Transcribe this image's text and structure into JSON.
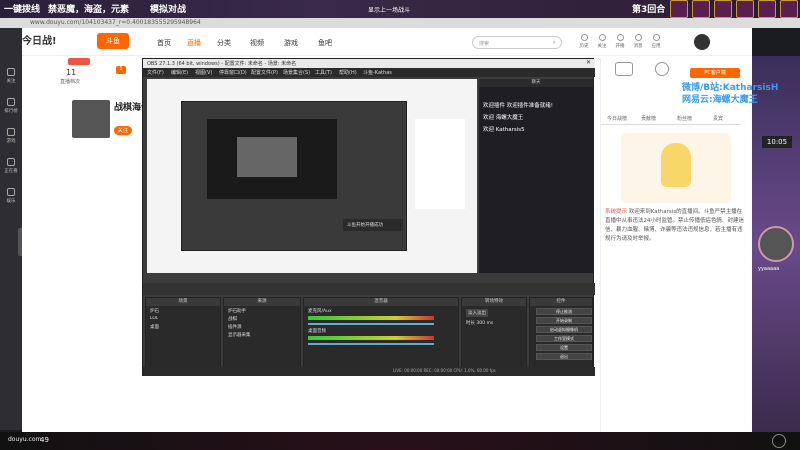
{
  "banner": {
    "promo": "一键拨线",
    "slogan": "禁恶魔，海盗，元素",
    "mode": "模拟对战",
    "center": "显示上一场战斗",
    "round": "第3回合"
  },
  "browser": {
    "url": "www.douyu.com/104103437_r=0.400183555295948964"
  },
  "nav": {
    "logo": "今日战!",
    "douyu": "斗鱼",
    "home": "首页",
    "live": "直播",
    "category": "分类",
    "video": "视频",
    "game": "游戏",
    "fishbar": "鱼吧",
    "search_placeholder": "搜索"
  },
  "top_icons": [
    {
      "label": "历史",
      "icon": "history-icon"
    },
    {
      "label": "关注",
      "icon": "follow-icon"
    },
    {
      "label": "开播",
      "icon": "broadcast-icon"
    },
    {
      "label": "消息",
      "icon": "message-icon"
    },
    {
      "label": "应用",
      "icon": "app-icon"
    }
  ],
  "left_sidebar": [
    {
      "label": "关注",
      "icon": "heart-icon"
    },
    {
      "label": "排行榜",
      "icon": "rank-icon"
    },
    {
      "label": "游戏",
      "icon": "game-icon"
    },
    {
      "label": "正在看",
      "icon": "watch-icon"
    },
    {
      "label": "娱乐",
      "icon": "fun-icon"
    }
  ],
  "meta": {
    "level": "11",
    "rank": "直播档次",
    "badge": "1"
  },
  "streamer": {
    "name": "战棋海士",
    "fans": "关注"
  },
  "obs": {
    "title": "OBS 27.1.3 (64 bit, windows) - 配置文件: 未命名 - 场景: 未命名",
    "menu": [
      "文件(F)",
      "编辑(E)",
      "视图(V)",
      "停靠窗口(D)",
      "配置文件(P)",
      "场景集合(S)",
      "工具(T)",
      "帮助(H)",
      "斗鱼-Kathas"
    ],
    "chat_header": "聊天",
    "chat": [
      "欢迎插件 欢迎插件准备就绪!",
      "欢迎 海螺大魔王",
      "欢迎 Katharsis5"
    ],
    "scenes_header": "场景",
    "sources_header": "来源",
    "mixer_header": "混音器",
    "transitions_header": "转场特效",
    "controls_header": "控件",
    "scenes": [
      "炉石",
      "LOL",
      "桌面"
    ],
    "sources": [
      "炉石助手",
      "战棋",
      "插件源",
      "显示器采集"
    ],
    "mixer": [
      "麦克风/Aux",
      "桌面音频"
    ],
    "transition_type": "淡入淡出",
    "duration": "时长 300 ms",
    "controls": [
      "停止推流",
      "开始录制",
      "启动虚拟摄像机",
      "工作室模式",
      "设置",
      "退出"
    ],
    "status": "LIVE: 00:00:00   REC: 00:00:00   CPU: 1.0%, 60.00 fps",
    "preview_caption": "斗鱼开始开播成功"
  },
  "right": {
    "pc_client": "PC客户端",
    "weibo": "微博/B站:KatharsisH",
    "netease": "网易云:海螺大魔王",
    "tabs": [
      "今日战榜",
      "贡献榜",
      "粉丝榜",
      "贵宾"
    ],
    "notice_label": "系统提示",
    "notice": "欢迎来到Katharsis的直播间。斗鱼严禁主播在直播中从事违法24小时监管。禁止传播低俗色情、封建迷信、暴力血腥、赌博、诈骗等违法违规信息，若主播有违规行为请及时举报。",
    "timer": "10:05",
    "fish_player": "yyaaaaa"
  },
  "bottom": {
    "fps": "49",
    "brand": "douyu.com"
  }
}
